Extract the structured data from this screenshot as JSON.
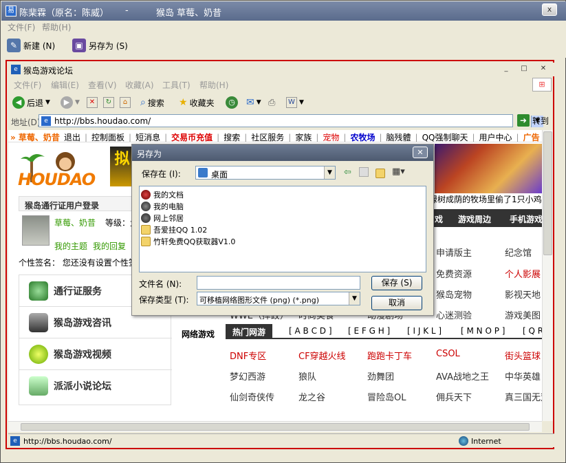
{
  "outer_window": {
    "title": "陈棐霖（原名：陈威）",
    "title_sep": "-",
    "title_right": "猴岛 草莓、奶昔",
    "close": "x",
    "menu": [
      "文件(F)",
      "帮助(H)"
    ],
    "toolbar": {
      "new": "新建 (N)",
      "save_as": "另存为 (S)"
    }
  },
  "browser": {
    "title": "猴岛游戏论坛",
    "menu": [
      "文件(F)",
      "编辑(E)",
      "查看(V)",
      "收藏(A)",
      "工具(T)",
      "帮助(H)"
    ],
    "toolbar": {
      "back": "后退",
      "search": "搜索",
      "favorites": "收藏夹"
    },
    "address_label": "地址(D)",
    "url": "http://bbs.houdao.com/",
    "go": "转到",
    "status_url": "http://bbs.houdao.com/",
    "status_zone": "Internet"
  },
  "webpage": {
    "nav": [
      {
        "text": "» 草莓、奶昔",
        "style": "org"
      },
      {
        "text": "退出",
        "style": ""
      },
      {
        "text": "|",
        "style": "sep"
      },
      {
        "text": "控制面板",
        "style": ""
      },
      {
        "text": "|",
        "style": "sep"
      },
      {
        "text": "短消息",
        "style": ""
      },
      {
        "text": "|",
        "style": "sep"
      },
      {
        "text": "交易币充值",
        "style": "red"
      },
      {
        "text": "|",
        "style": "sep"
      },
      {
        "text": "搜索",
        "style": ""
      },
      {
        "text": "|",
        "style": "sep"
      },
      {
        "text": "社区服务",
        "style": ""
      },
      {
        "text": "|",
        "style": "sep"
      },
      {
        "text": "家族",
        "style": ""
      },
      {
        "text": "|",
        "style": "sep"
      },
      {
        "text": "宠物",
        "style": "redn"
      },
      {
        "text": "|",
        "style": "sep"
      },
      {
        "text": "农牧场",
        "style": "blu"
      },
      {
        "text": "|",
        "style": "sep"
      },
      {
        "text": "脑残體",
        "style": ""
      },
      {
        "text": "|",
        "style": "sep"
      },
      {
        "text": "QQ强制聊天",
        "style": ""
      },
      {
        "text": "|",
        "style": "sep"
      },
      {
        "text": "用户中心",
        "style": ""
      },
      {
        "text": "|",
        "style": "sep"
      },
      {
        "text": "广告",
        "style": "org"
      }
    ],
    "logo_text": "HOUDAO",
    "banner_text": "拟",
    "login": {
      "header": "猴岛通行证用户登录",
      "username": "草莓、奶昔",
      "level_label": "等级：大",
      "my_topics": "我的主题",
      "my_replies": "我的回复",
      "signature": "个性签名：  您还没有设置个性签名"
    },
    "left_menu": [
      "通行证服务",
      "猴岛游戏咨讯",
      "猴岛游戏视频",
      "派派小说论坛"
    ],
    "marquee": "绿树成荫的牧场里偷了1只小鸡",
    "header_nav": [
      "戏",
      "游戏周边",
      "手机游戏"
    ],
    "link_grid": [
      [
        "申请版主",
        "纪念馆"
      ],
      [
        "免费资源",
        "个人影展"
      ],
      [
        "猴岛宠物",
        "影视天地"
      ],
      [
        "WWE（摔跤）",
        "时尚美食",
        "动漫剧场",
        "心迷测验",
        "游戏美图"
      ]
    ],
    "game_section_label": "网络游戏",
    "game_tabs": [
      "热门网游",
      "[ A B C D ]",
      "[ E F G H ]",
      "[ I J K L ]",
      "[ M N O P ]",
      "[ Q R"
    ],
    "games": [
      [
        "DNF专区",
        "CF穿越火线",
        "跑跑卡丁车",
        "CSOL",
        "街头篮球"
      ],
      [
        "梦幻西游",
        "狼队",
        "劲舞团",
        "AVA战地之王",
        "中华英雄"
      ],
      [
        "仙剑奇侠传",
        "龙之谷",
        "冒险岛OL",
        "佣兵天下",
        "真三国无双"
      ]
    ]
  },
  "save_dialog": {
    "title": "另存为",
    "save_in_label": "保存在 (I):",
    "save_in_value": "桌面",
    "items": [
      "我的文档",
      "我的电脑",
      "网上邻居",
      "吾爱挂QQ 1.02",
      "竹轩免费QQ获取器V1.0"
    ],
    "filename_label": "文件名 (N):",
    "filename_value": "",
    "filetype_label": "保存类型 (T):",
    "filetype_value": "可移植网络图形文件 (png) (*.png)",
    "save_button": "保存 (S)",
    "cancel_button": "取消"
  },
  "colors": {
    "accent": "#d00000",
    "link_green": "#339900",
    "title_bar": "#5a6b8c"
  }
}
